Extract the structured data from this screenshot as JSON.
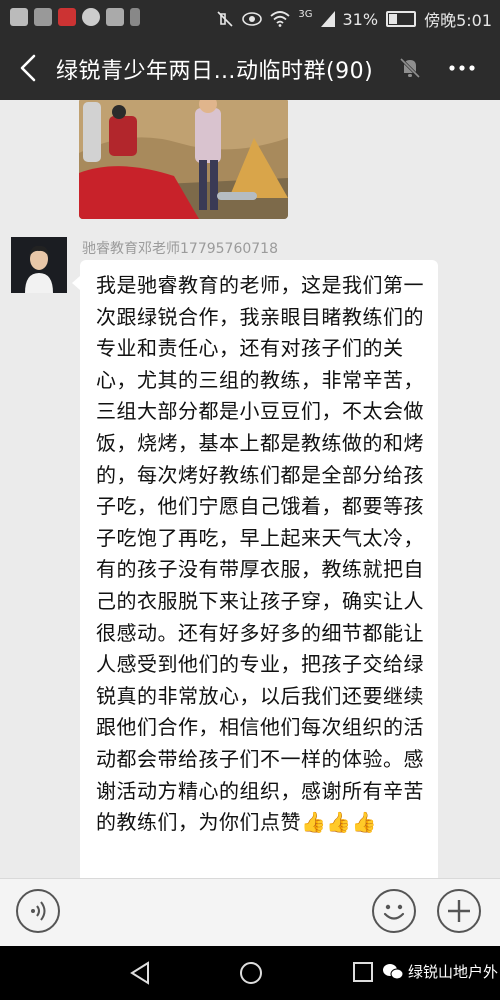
{
  "status_bar": {
    "signal_label": "3G",
    "battery_text": "31%",
    "battery_level": 0.31,
    "time": "傍晚5:01"
  },
  "header": {
    "title": "绿锐青少年两日…动临时群(90)",
    "back_icon": "chevron-left-icon",
    "mute_icon": "bell-off-icon",
    "more_icon": "more-dots-icon"
  },
  "chat": {
    "sender_name": "驰睿教育邓老师17795760718",
    "message_text": "我是驰睿教育的老师，这是我们第一次跟绿锐合作，我亲眼目睹教练们的专业和责任心，还有对孩子们的关心，尤其的三组的教练，非常辛苦，三组大部分都是小豆豆们，不太会做饭，烧烤，基本上都是教练做的和烤的，每次烤好教练们都是全部分给孩子吃，他们宁愿自己饿着，都要等孩子吃饱了再吃，早上起来天气太冷，有的孩子没有带厚衣服，教练就把自己的衣服脱下来让孩子穿，确实让人很感动。还有好多好多的细节都能让人感受到他们的专业，把孩子交给绿锐真的非常放心，以后我们还要继续跟他们合作，相信他们每次组织的活动都会带给孩子们不一样的体验。感谢活动方精心的组织，感谢所有辛苦的教练们，为你们点赞",
    "thumbs": "👍👍👍"
  },
  "input_bar": {
    "voice_icon": "voice-icon",
    "emoji_icon": "emoji-icon",
    "plus_icon": "plus-icon"
  },
  "watermark": "绿锐山地户外",
  "colors": {
    "bar_dark": "#2c2c2c",
    "chat_bg": "#ebebeb",
    "bubble_bg": "#ffffff",
    "accent_thumb": "#f2b632"
  }
}
